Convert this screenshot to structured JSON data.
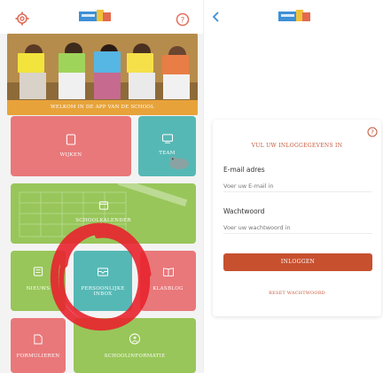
{
  "colors": {
    "red_tile": "#e9787a",
    "teal_tile": "#56b8b5",
    "green_tile": "#98c65a",
    "login_button": "#c7502f",
    "accent_text": "#c4583b",
    "caption_bar": "#e7a33a",
    "scribble": "#e8242e"
  },
  "left_screen": {
    "header": {
      "left_icon": "gear-icon",
      "right_icon": "help-icon"
    },
    "hero": {
      "caption": "WELKOM IN DE APP VAN DE SCHOOL"
    },
    "tiles": [
      {
        "id": "wijken",
        "label": "WIJKEN",
        "icon": "document-icon",
        "color": "red"
      },
      {
        "id": "team",
        "label": "TEAM",
        "icon": "team-icon",
        "color": "teal"
      },
      {
        "id": "schoolkalender",
        "label": "SCHOOLKALENDER",
        "icon": "calendar-icon",
        "color": "green"
      },
      {
        "id": "nieuws",
        "label": "NIEUWS",
        "icon": "news-icon",
        "color": "green"
      },
      {
        "id": "persoonlijke-inbox",
        "label": "PERSOONLIJKE INBOX",
        "icon": "inbox-icon",
        "color": "teal"
      },
      {
        "id": "klasblog",
        "label": "KLASBLOG",
        "icon": "book-icon",
        "color": "red"
      },
      {
        "id": "formulieren",
        "label": "FORMULIEREN",
        "icon": "form-icon",
        "color": "red"
      },
      {
        "id": "schoolinformatie",
        "label": "SCHOOLINFORMATIE",
        "icon": "info-icon",
        "color": "green"
      }
    ]
  },
  "right_screen": {
    "header": {
      "back_icon": "chevron-left-icon"
    },
    "login_card": {
      "title": "VUL UW INLOGGEGEVENS IN",
      "email_label": "E-mail adres",
      "email_placeholder": "Voer uw E-mail in",
      "password_label": "Wachtwoord",
      "password_placeholder": "Voer uw wachtwoord in",
      "login_button": "INLOGGEN",
      "reset_link": "RESET WACHTWOORD"
    }
  }
}
